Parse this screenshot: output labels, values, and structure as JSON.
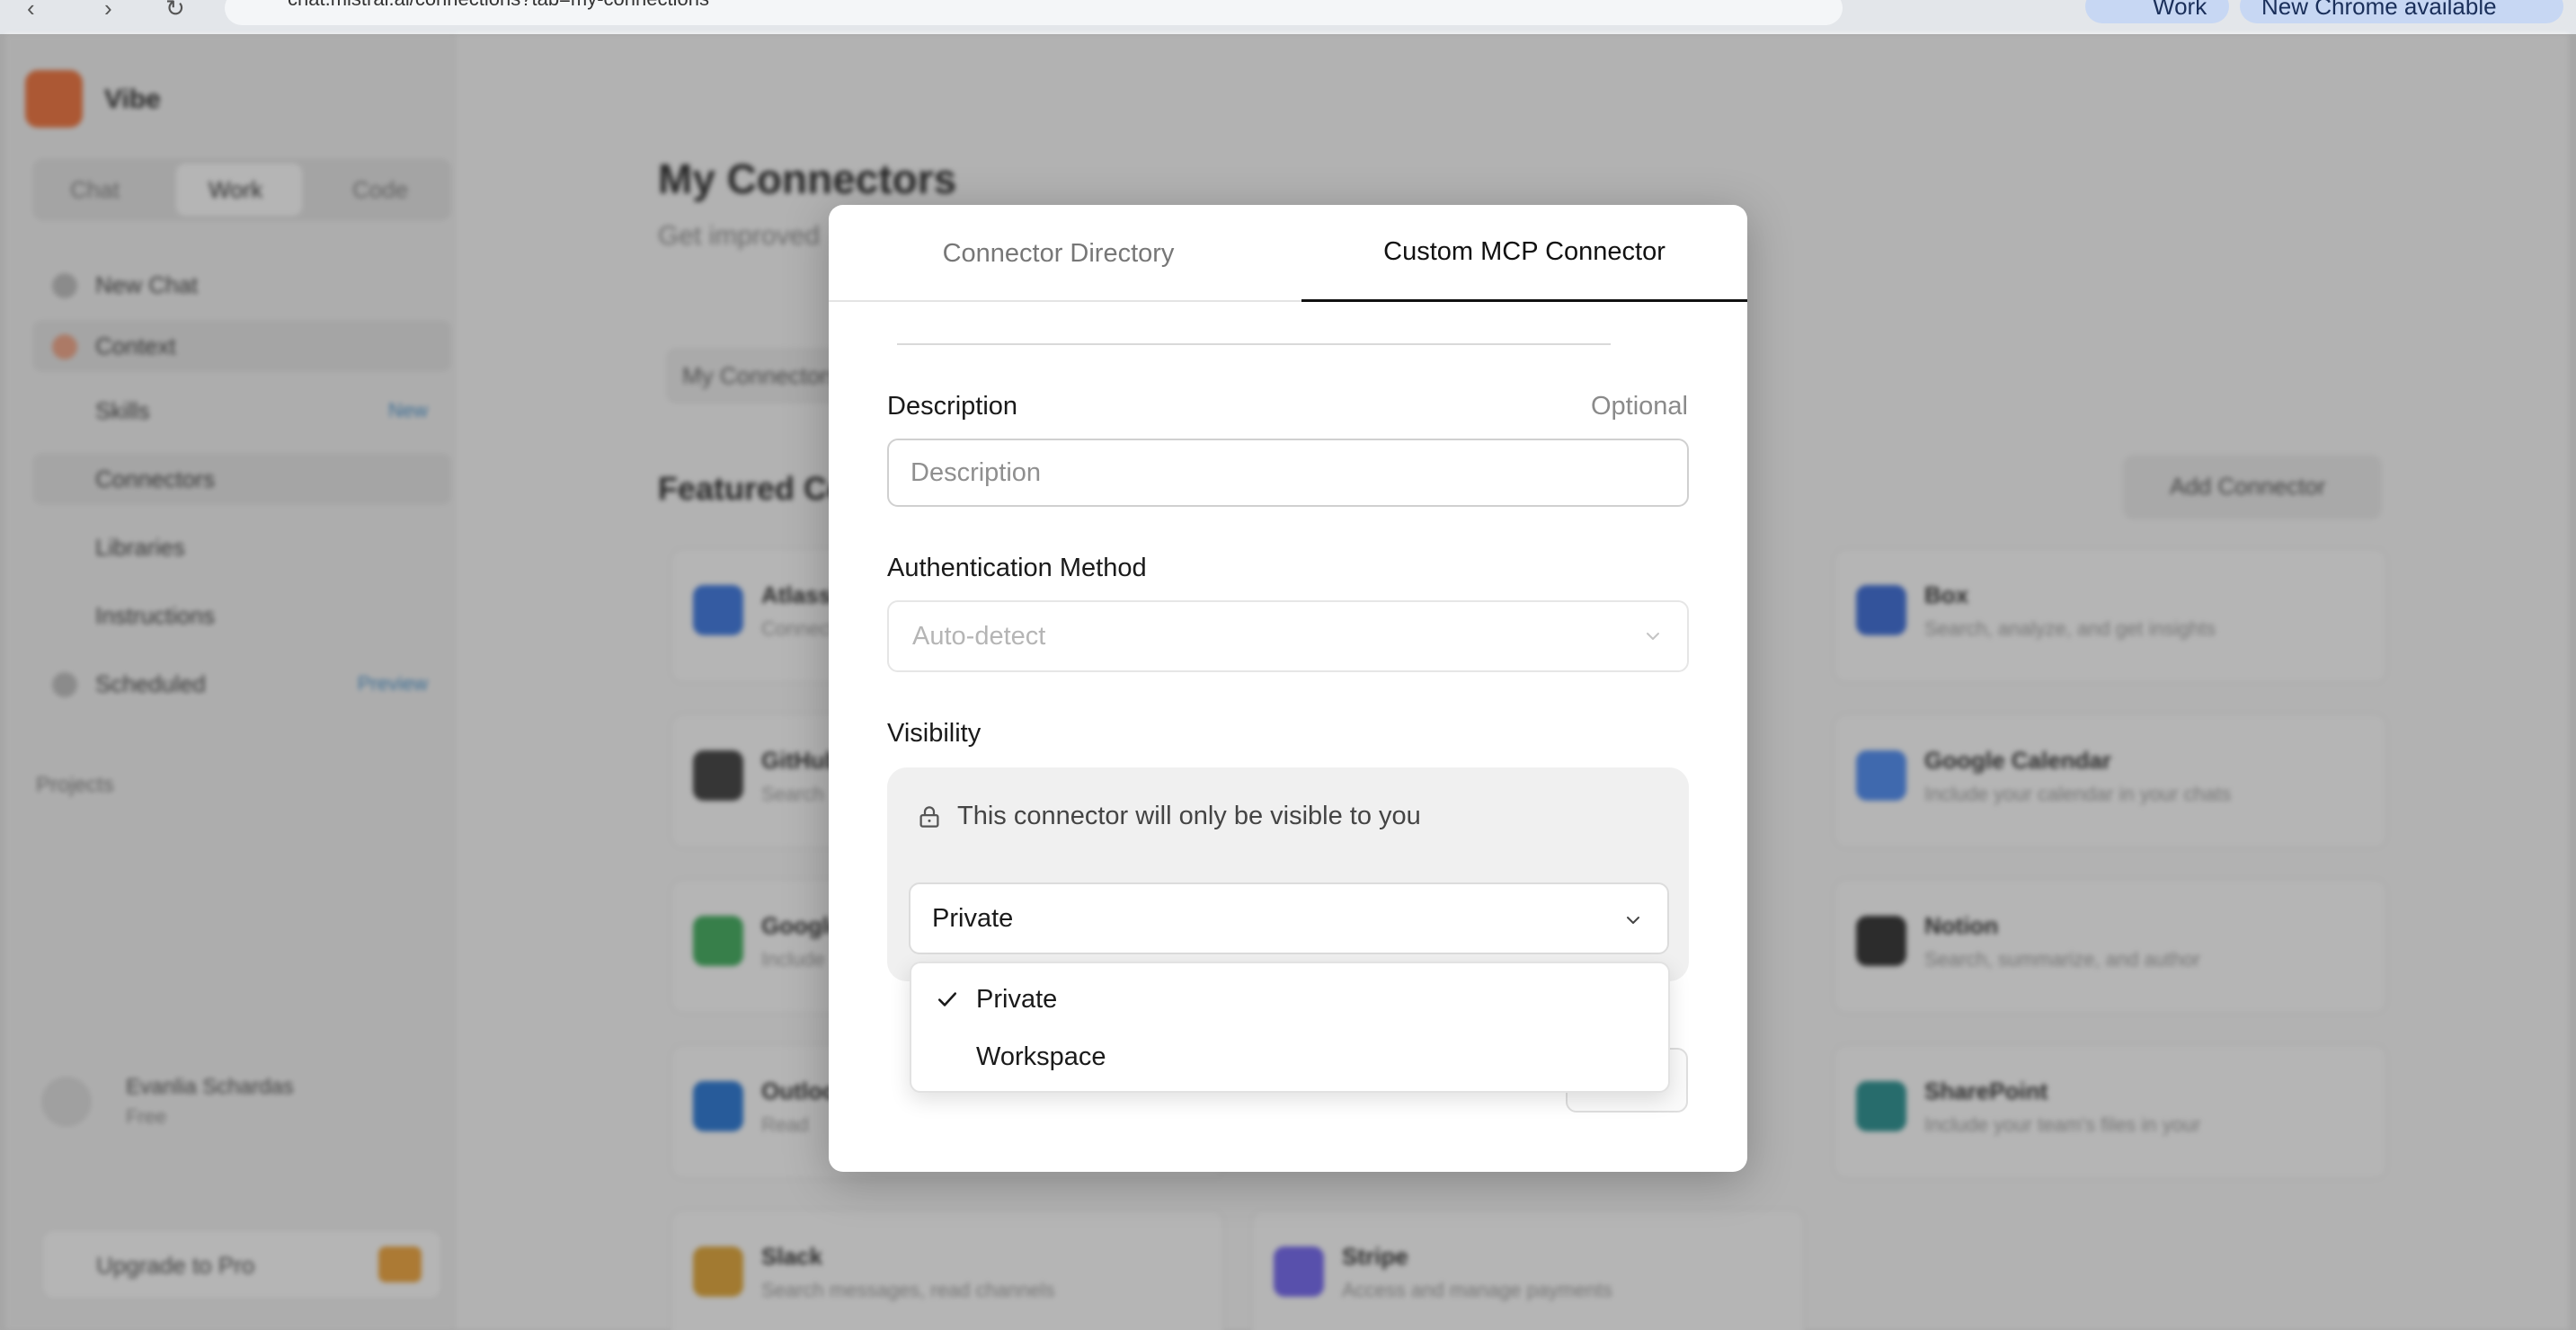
{
  "browser": {
    "url": "chat.mistral.ai/connections?tab=my-connections",
    "profile_label": "Work",
    "update_label": "New Chrome available"
  },
  "background": {
    "workspace": "Vibe",
    "segments": [
      "Chat",
      "Work",
      "Code"
    ],
    "sidebar_items": [
      {
        "label": "New Chat",
        "badge": ""
      },
      {
        "label": "Context",
        "badge": ""
      },
      {
        "label": "Skills",
        "badge": "New"
      },
      {
        "label": "Connectors",
        "badge": ""
      },
      {
        "label": "Libraries",
        "badge": ""
      },
      {
        "label": "Instructions",
        "badge": ""
      },
      {
        "label": "Scheduled",
        "badge": "Preview"
      }
    ],
    "projects_label": "Projects",
    "user_name": "Evanlia Schardas",
    "user_plan": "Free",
    "upgrade_label": "Upgrade to Pro",
    "page_title": "My Connectors",
    "page_subtitle": "Get improved",
    "tab_label": "My Connectors",
    "featured_label": "Featured Connectors",
    "add_connector_label": "Add Connector",
    "cards": [
      {
        "name": "Atlassian",
        "desc": "Connect",
        "color": "#2f6fe0"
      },
      {
        "name": "Box",
        "desc": "Search, analyze, and get insights",
        "color": "#2e62d6"
      },
      {
        "name": "GitHub",
        "desc": "Search",
        "color": "#333333"
      },
      {
        "name": "Google Calendar",
        "desc": "Include your calendar in your chats",
        "color": "#4285f4"
      },
      {
        "name": "Google Drive",
        "desc": "Include",
        "color": "#34a853"
      },
      {
        "name": "Notion",
        "desc": "Search, summarize, and author",
        "color": "#222222"
      },
      {
        "name": "Outlook",
        "desc": "Read",
        "color": "#1a6fd4"
      },
      {
        "name": "SharePoint",
        "desc": "Include your team's files in your",
        "color": "#1b8a8a"
      },
      {
        "name": "Slack",
        "desc": "Search messages, read channels",
        "color": "#e0a12a"
      },
      {
        "name": "Stripe",
        "desc": "Access and manage payments",
        "color": "#6a5cf0"
      }
    ]
  },
  "modal": {
    "tabs": [
      {
        "label": "Connector Directory",
        "active": false
      },
      {
        "label": "Custom MCP Connector",
        "active": true
      }
    ],
    "description": {
      "label": "Description",
      "optional": "Optional",
      "placeholder": "Description",
      "value": ""
    },
    "auth": {
      "label": "Authentication Method",
      "value": "Auto-detect"
    },
    "visibility": {
      "label": "Visibility",
      "note": "This connector will only be visible to you",
      "selected": "Private",
      "options": [
        {
          "label": "Private",
          "checked": true
        },
        {
          "label": "Workspace",
          "checked": false
        }
      ]
    }
  }
}
